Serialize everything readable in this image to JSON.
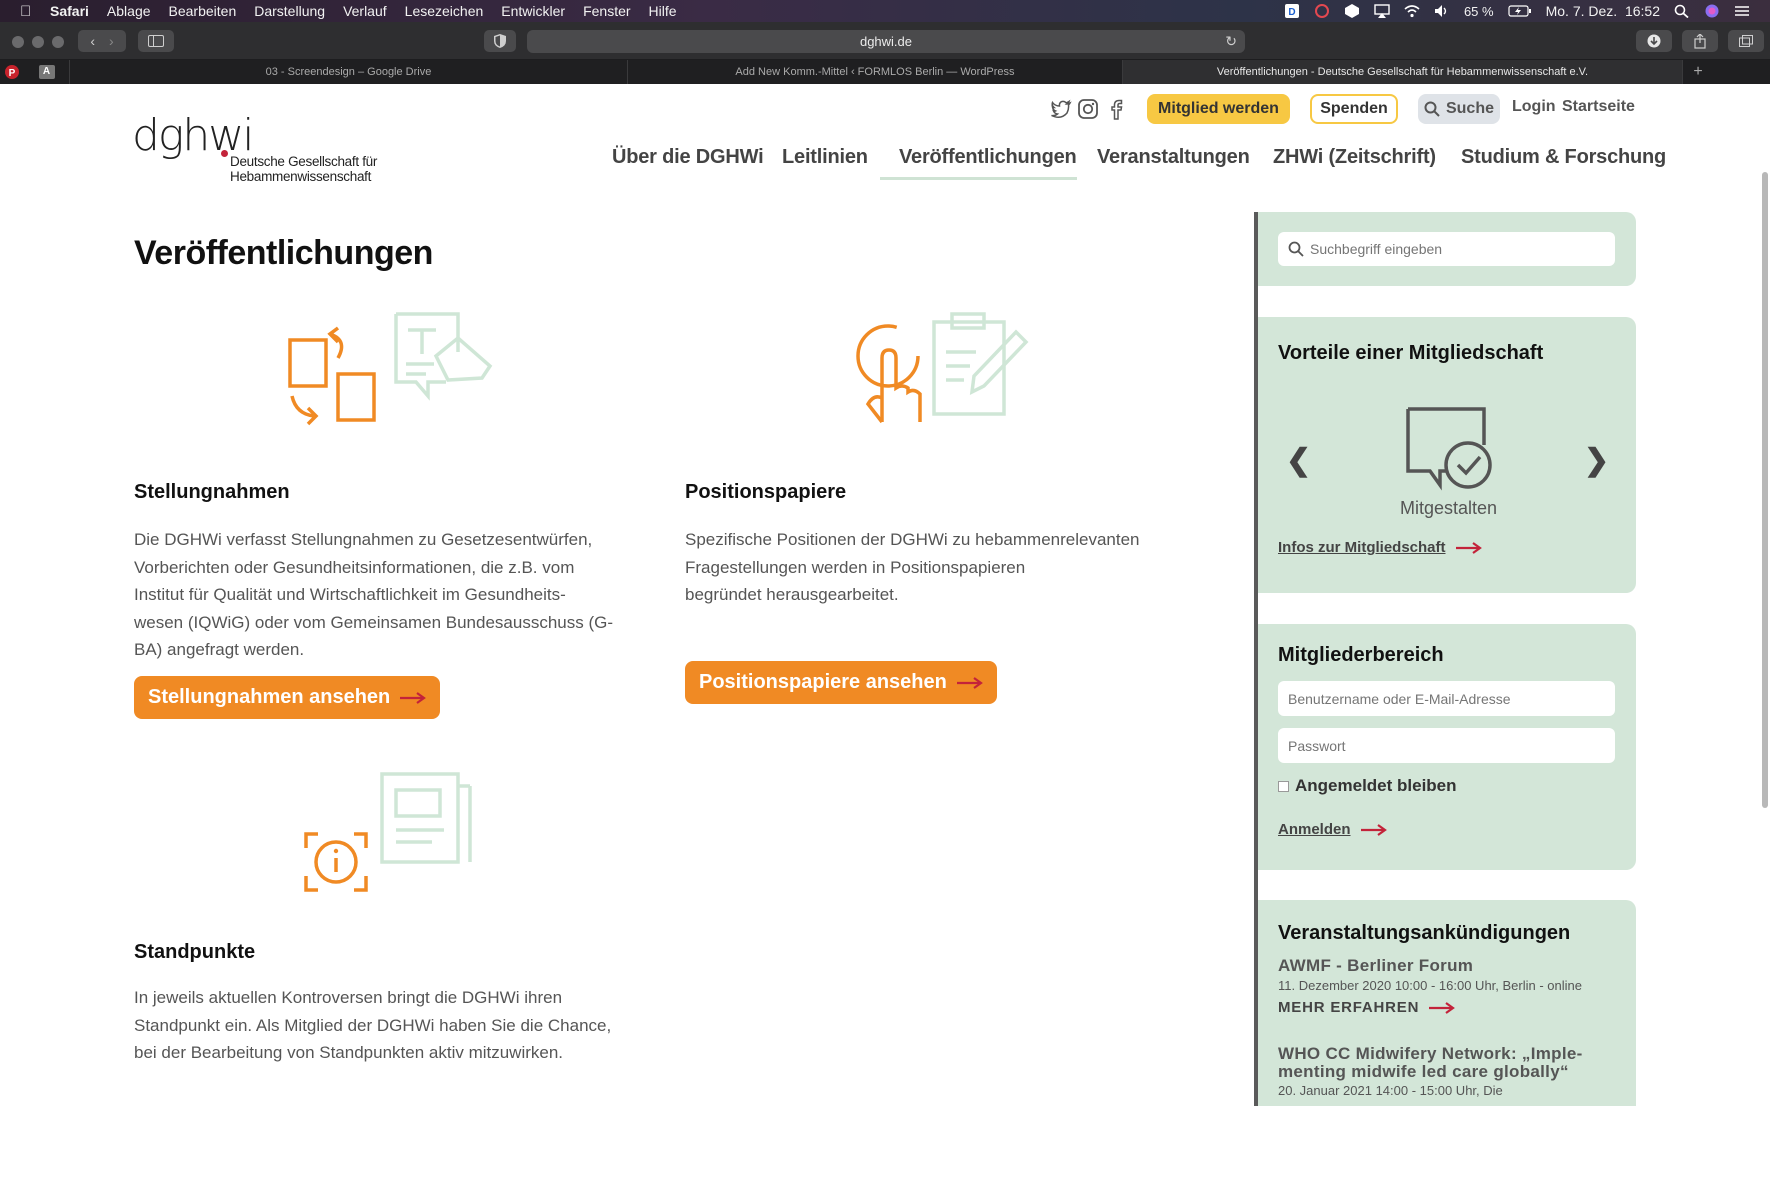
{
  "menubar": {
    "app": "Safari",
    "items": [
      "Ablage",
      "Bearbeiten",
      "Darstellung",
      "Verlauf",
      "Lesezeichen",
      "Entwickler",
      "Fenster",
      "Hilfe"
    ],
    "battery": "65 %",
    "clock": "Mo. 7. Dez.  16:52"
  },
  "browser": {
    "url": "dghwi.de",
    "tabs": [
      {
        "label": "03 - Screendesign – Google Drive",
        "active": false
      },
      {
        "label": "Add New Komm.-Mittel ‹ FORMLOS Berlin — WordPress",
        "active": false
      },
      {
        "label": "Veröffentlichungen - Deutsche Gesellschaft für Hebammenwissenschaft e.V.",
        "active": true
      }
    ],
    "pinned_tab_letter": "A"
  },
  "header": {
    "logo_mark": "dghwi",
    "logo_line1": "Deutsche Gesellschaft für",
    "logo_line2": "Hebammenwissenschaft",
    "member_button": "Mitglied werden",
    "donate_button": "Spenden",
    "search_button": "Suche",
    "login": "Login",
    "home": "Startseite"
  },
  "nav": {
    "items": [
      {
        "label": "Über die DGHWi"
      },
      {
        "label": "Leitlinien"
      },
      {
        "label": "Veröffentlichungen"
      },
      {
        "label": "Veranstaltungen"
      },
      {
        "label": "ZHWi (Zeitschrift)"
      },
      {
        "label": "Studium & Forschung"
      }
    ],
    "active_index": 2
  },
  "main": {
    "title": "Veröffentlichungen",
    "sections": [
      {
        "title": "Stellungnahmen",
        "text_lines": [
          "Die DGHWi verfasst Stellungnahmen zu Gesetzesentwürfen,",
          "Vorberichten oder Gesundheitsinformationen, die z.B. vom",
          "Institut für Qualität und Wirtschaftlichkeit im Gesundheits-",
          "wesen (IQWiG) oder vom Gemeinsamen Bundesausschuss (G-",
          "BA) angefragt werden."
        ],
        "button": "Stellungnahmen ansehen"
      },
      {
        "title": "Positionspapiere",
        "text_lines": [
          "Spezifische Positionen der DGHWi zu hebammenrelevanten",
          "Fragestellungen werden in Positionspapieren",
          "begründet herausgearbeitet."
        ],
        "button": "Positionspapiere ansehen"
      },
      {
        "title": "Standpunkte",
        "text_lines": [
          "In jeweils aktuellen Kontroversen bringt die DGHWi ihren",
          "Standpunkt ein. Als Mitglied der DGHWi haben Sie die Chance,",
          "bei der Bearbeitung von Standpunkten aktiv mitzuwirken."
        ]
      }
    ]
  },
  "sidebar": {
    "search_placeholder": "Suchbegriff eingeben",
    "benefits": {
      "title": "Vorteile einer Mitgliedschaft",
      "slide_label": "Mitgestalten",
      "link": "Infos zur Mitgliedschaft"
    },
    "members": {
      "title": "Mitgliederbereich",
      "username_placeholder": "Benutzername oder E-Mail-Adresse",
      "password_placeholder": "Passwort",
      "remember": "Angemeldet bleiben",
      "login": "Anmelden"
    },
    "events": {
      "title": "Veranstaltungsankündigungen",
      "items": [
        {
          "title": "AWMF - Berliner Forum",
          "date": "11. Dezember 2020 10:00 - 16:00 Uhr, Berlin - online",
          "more": "MEHR ERFAHREN"
        },
        {
          "title_lines": [
            "WHO CC Midwifery Network: „Imple-",
            "menting midwife led care globally“"
          ],
          "date": "20. Januar 2021 14:00 - 15:00 Uhr, Die"
        }
      ]
    }
  },
  "colors": {
    "orange": "#f08a24",
    "yellow": "#f7c843",
    "mint": "#d3e6d8",
    "arrow_red": "#c3233a"
  }
}
